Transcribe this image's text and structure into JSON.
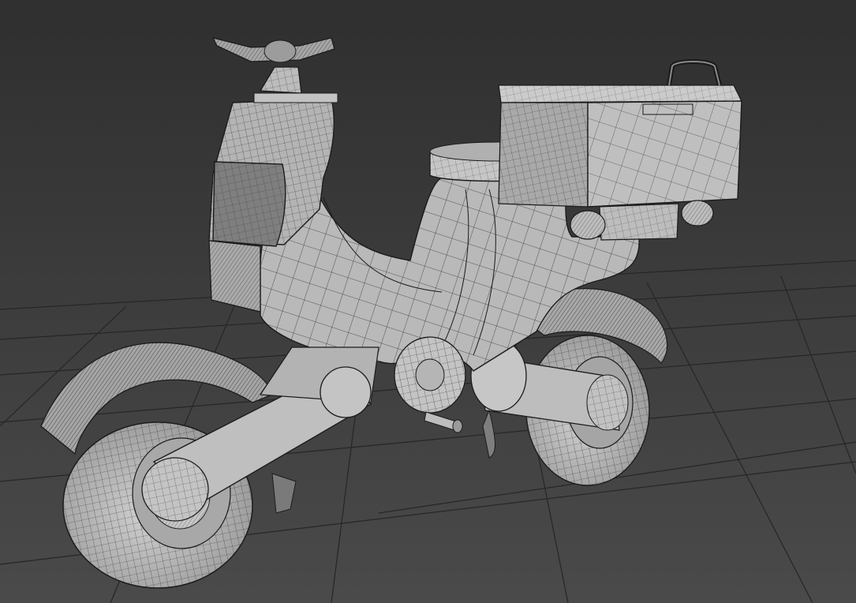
{
  "viewport": {
    "background_top": "#2f2f2f",
    "background_bottom": "#4a4a4a",
    "grid_color": "#262626",
    "model_fill": "#b9b9b9",
    "model_fill_dark": "#8e8e8e",
    "wire_color": "#1c1c1c"
  },
  "model": {
    "parts": [
      "rear-wheel",
      "rear-fender",
      "swingarm",
      "front-wheel",
      "front-fender",
      "front-suspension-arm",
      "engine-hub",
      "kickstand",
      "body-shell",
      "front-apron",
      "headlight-panel",
      "handlebar",
      "seat",
      "cargo-box",
      "cargo-box-handle",
      "cargo-rack-rollers"
    ]
  }
}
